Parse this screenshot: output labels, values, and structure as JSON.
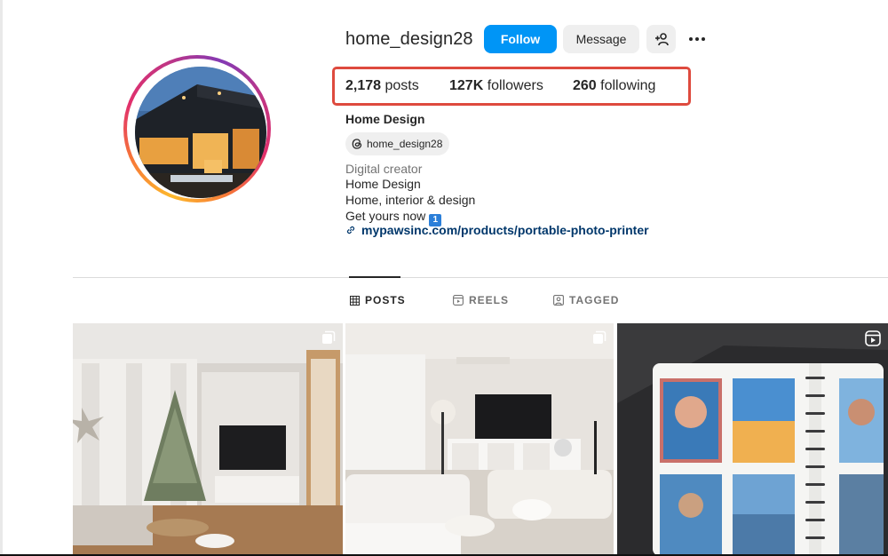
{
  "profile": {
    "username": "home_design28",
    "follow_label": "Follow",
    "message_label": "Message",
    "full_name": "Home Design",
    "threads_handle": "home_design28"
  },
  "stats": {
    "posts_count": "2,178",
    "posts_label": "posts",
    "followers_count": "127K",
    "followers_label": "followers",
    "following_count": "260",
    "following_label": "following"
  },
  "bio": {
    "category": "Digital creator",
    "line1": "Home Design",
    "line2": "Home, interior & design",
    "line3": "Get yours now",
    "line3_badge": "1",
    "link": "mypawsinc.com/products/portable-photo-printer"
  },
  "tabs": [
    {
      "label": "POSTS",
      "icon": "grid-icon",
      "active": true
    },
    {
      "label": "REELS",
      "icon": "reels-icon",
      "active": false
    },
    {
      "label": "TAGGED",
      "icon": "tagged-icon",
      "active": false
    }
  ],
  "posts": [
    {
      "description": "living-room-christmas-tree",
      "type_icon": "carousel-icon"
    },
    {
      "description": "white-living-room-tv",
      "type_icon": "carousel-icon"
    },
    {
      "description": "photo-album-prints",
      "type_icon": "reel-icon"
    }
  ],
  "colors": {
    "accent": "#0095f6",
    "highlight_box": "#de4a3e",
    "link": "#00376b"
  }
}
